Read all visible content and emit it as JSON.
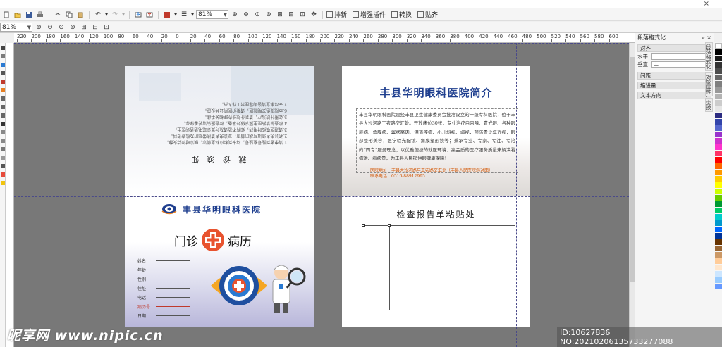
{
  "window": {
    "close_glyph": "×"
  },
  "toolbar": {
    "zoom_value": "81%",
    "buttons": [
      "new-icon",
      "open-icon",
      "save-icon",
      "print-icon",
      "cut-icon",
      "copy-icon",
      "paste-icon",
      "undo-icon",
      "redo-icon",
      "import-icon",
      "export-icon"
    ],
    "text_buttons": [
      {
        "label": "排新",
        "icon": "arrange-icon"
      },
      {
        "label": "增强插件",
        "icon": "plugin-icon"
      },
      {
        "label": "转换",
        "icon": "convert-icon"
      },
      {
        "label": "贴齐",
        "icon": "snap-icon"
      }
    ],
    "zoom_value_2": "81%"
  },
  "ruler": {
    "ticks": [
      "220",
      "200",
      "180",
      "160",
      "140",
      "120",
      "100",
      "80",
      "60",
      "40",
      "20",
      "0",
      "20",
      "40",
      "60",
      "80",
      "100",
      "120",
      "140",
      "160",
      "180",
      "200",
      "220",
      "240",
      "260",
      "280",
      "300",
      "320",
      "340",
      "360",
      "380",
      "400",
      "420",
      "440",
      "460",
      "480",
      "500",
      "520",
      "540",
      "560",
      "580",
      "600"
    ]
  },
  "left_page": {
    "flipped_title": "就 诊 须 知",
    "flipped_lines": [
      "1.请患者到挂号室挂号，持卡到相应科室就诊，候诊时保持安静。",
      "2.初诊患者须填写病历首页，复诊患者请携带病历及检查资料。",
      "3.请遵医嘱按时用药，如有不适请及时复诊或电话咨询医生。",
      "4.检查前请按医生要求做好准备，检查报告请妥善保存。",
      "5.如需住院治疗，请到住院处办理相关手续。",
      "6.本院提倡文明就医，请爱护医院公共设施。",
      "7.未尽事宜请咨询导医台工作人员。"
    ],
    "hospital_name": "丰县华明眼科医院",
    "record_left": "门诊",
    "record_right": "病历",
    "fields": [
      "姓名",
      "年龄",
      "性别",
      "住址",
      "电话",
      "病历号",
      "日期"
    ]
  },
  "right_page": {
    "title": "丰县华明眼科医院简介",
    "intro": "丰县华明眼科医院是经丰县卫生健康委员会批准设立的一级专科医院，位于丰县大沙河路工农路交汇处。开放床位30张，专业治疗白内障、青光眼、各种眼底病、角膜病、翼状胬肉、泪道疾病、小儿斜视、弱视，预防青少年近视，眼部整形美容，医学验光配镜、角膜塑形镜等；秉承专业、专家、专注、专治的“四专”服务理念，以优雅便捷的就医环境、高品质的医疗服务质量来解决看病难、看病贵，为丰县人民提供眼健康保障！",
    "contact_address": "医院地址：丰县大沙河路与工农路交汇处（丰县人民医院斜对面）",
    "contact_phone": "联系电话：0516-88912995",
    "subtitle": "检查报告单粘贴处"
  },
  "docker": {
    "title": "段落格式化",
    "sections": [
      {
        "label": "对齐",
        "open": true
      },
      {
        "label": "间距",
        "open": false
      },
      {
        "label": "缩进量",
        "open": false
      },
      {
        "label": "文本方向",
        "open": false
      }
    ],
    "align_h_label": "水平",
    "align_v_label": "垂直",
    "align_v_value": "上",
    "vtabs": [
      "段落格式化",
      "对象属性",
      "变换"
    ]
  },
  "palette": {
    "colors": [
      "#ffffff",
      "#000000",
      "#1a1a1a",
      "#333333",
      "#4d4d4d",
      "#666666",
      "#808080",
      "#999999",
      "#b3b3b3",
      "#cccccc",
      "#e6e6e6",
      "#2b2b80",
      "#3344aa",
      "#5566cc",
      "#9933cc",
      "#cc33cc",
      "#ff33cc",
      "#ff3366",
      "#ff0000",
      "#ff6600",
      "#ff9900",
      "#ffcc00",
      "#ffff00",
      "#ccff00",
      "#66cc00",
      "#009933",
      "#00cc66",
      "#00cccc",
      "#0099cc",
      "#0066ff",
      "#003399",
      "#663300",
      "#996633",
      "#cc9966",
      "#ffcc99",
      "#ffe6cc",
      "#cce6ff",
      "#99ccff",
      "#6699ff"
    ]
  },
  "watermark": {
    "site": "昵享网 www.nipic.cn",
    "id": "ID:10627836 NO:20210206135733277088"
  }
}
